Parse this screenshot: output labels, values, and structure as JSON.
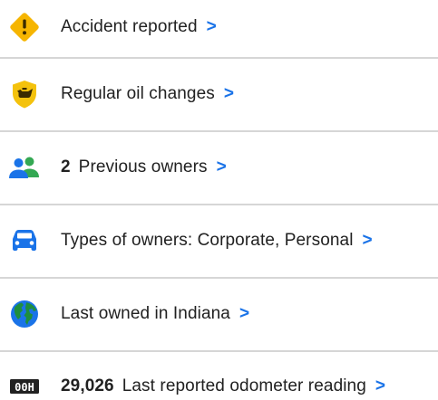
{
  "history_items": [
    {
      "icon": "warning-diamond-icon",
      "count": "",
      "label": "Accident reported",
      "chevron": ">"
    },
    {
      "icon": "oil-can-shield-icon",
      "count": "",
      "label": "Regular oil changes",
      "chevron": ">"
    },
    {
      "icon": "people-icon",
      "count": "2",
      "label": "Previous owners",
      "chevron": ">"
    },
    {
      "icon": "car-icon",
      "count": "",
      "label": "Types of owners: Corporate, Personal",
      "chevron": ">"
    },
    {
      "icon": "globe-icon",
      "count": "",
      "label": "Last owned in Indiana",
      "chevron": ">"
    },
    {
      "icon": "odometer-icon",
      "count": "29,026",
      "label": "Last reported odometer reading",
      "chevron": ">",
      "icon_text": "00H"
    }
  ],
  "colors": {
    "warning": "#f6b500",
    "oil_shield": "#f4c20d",
    "owners_green": "#34a853",
    "owners_blue": "#1a73e8",
    "car_blue": "#1a73e8",
    "globe_blue": "#1a73e8",
    "globe_green": "#1e8e3e",
    "chevron": "#1a73e8",
    "divider": "#d6d6d6"
  }
}
